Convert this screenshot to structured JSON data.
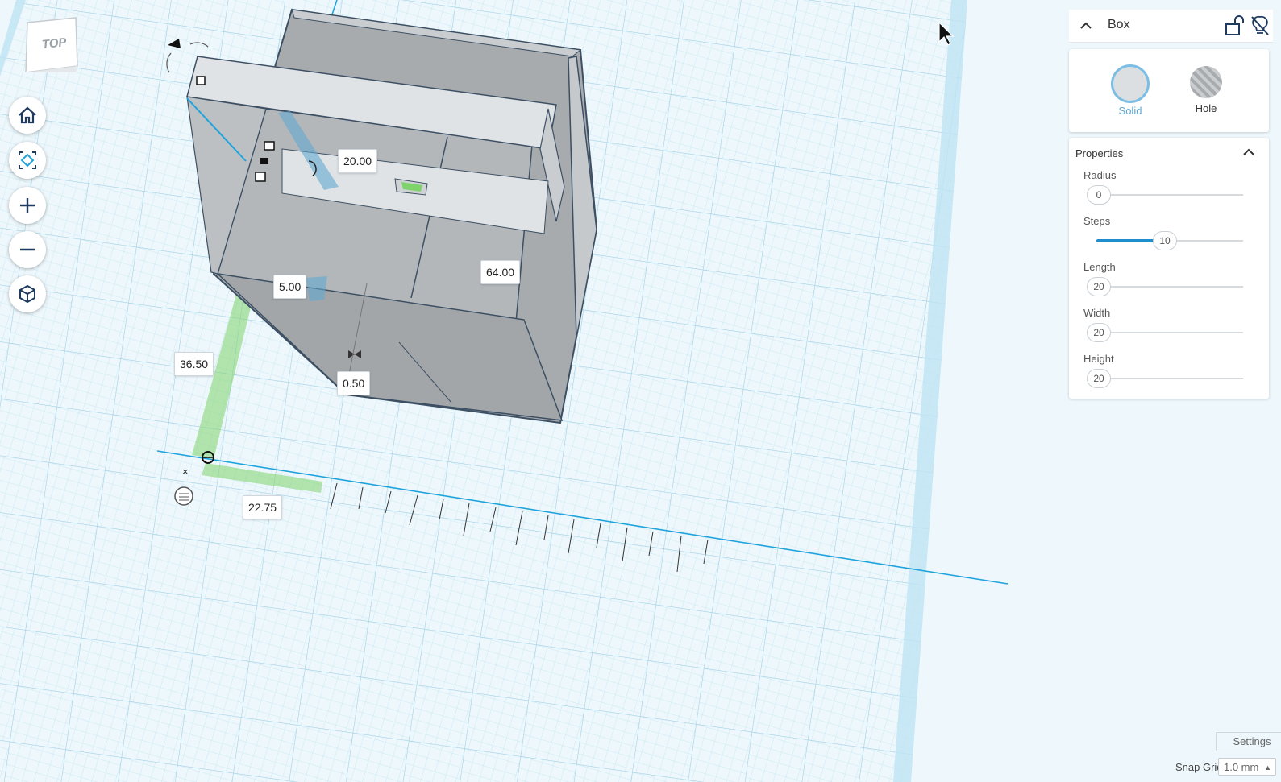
{
  "viewcube": {
    "face_label": "TOP"
  },
  "dimensions": {
    "top_width": "20.00",
    "wall_thickness": "5.00",
    "depth": "64.00",
    "y_offset": "36.50",
    "gap": "0.50",
    "x_offset": "22.75"
  },
  "shape_panel": {
    "title": "Box",
    "solid_label": "Solid",
    "hole_label": "Hole",
    "selected": "Solid"
  },
  "properties": {
    "header": "Properties",
    "items": [
      {
        "label": "Radius",
        "value": "0",
        "fraction": 0.0
      },
      {
        "label": "Steps",
        "value": "10",
        "fraction": 0.45
      },
      {
        "label": "Length",
        "value": "20",
        "fraction": 0.0
      },
      {
        "label": "Width",
        "value": "20",
        "fraction": 0.0
      },
      {
        "label": "Height",
        "value": "20",
        "fraction": 0.0
      }
    ]
  },
  "footer": {
    "settings_label": "Settings",
    "snap_grid_label": "Snap Grid",
    "snap_grid_value": "1.0 mm"
  },
  "colors": {
    "grid_background": "#e9f5fb",
    "grid_line": "#b9dcec",
    "accent_blue": "#1fa3dc",
    "selection_green": "#7fd36b",
    "shape_gray": "#a7abae"
  }
}
